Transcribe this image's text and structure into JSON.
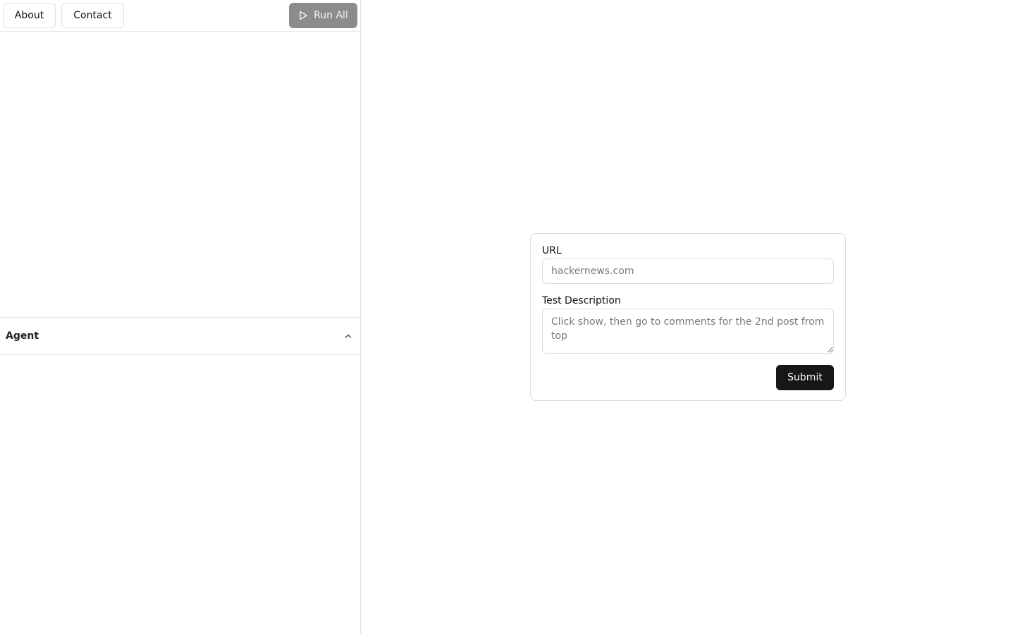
{
  "nav": {
    "about_label": "About",
    "contact_label": "Contact",
    "run_all_label": "Run All",
    "run_all_icon": "play-icon"
  },
  "agent_panel": {
    "title": "Agent",
    "toggle_icon": "chevron-up-icon"
  },
  "form": {
    "url_label": "URL",
    "url_placeholder": "hackernews.com",
    "url_value": "",
    "description_label": "Test Description",
    "description_placeholder": "Click show, then go to comments for the 2nd post from top",
    "description_value": "",
    "submit_label": "Submit"
  },
  "colors": {
    "run_all_bg": "#8c8c8c",
    "submit_bg": "#171717",
    "border": "#e5e5e5"
  }
}
